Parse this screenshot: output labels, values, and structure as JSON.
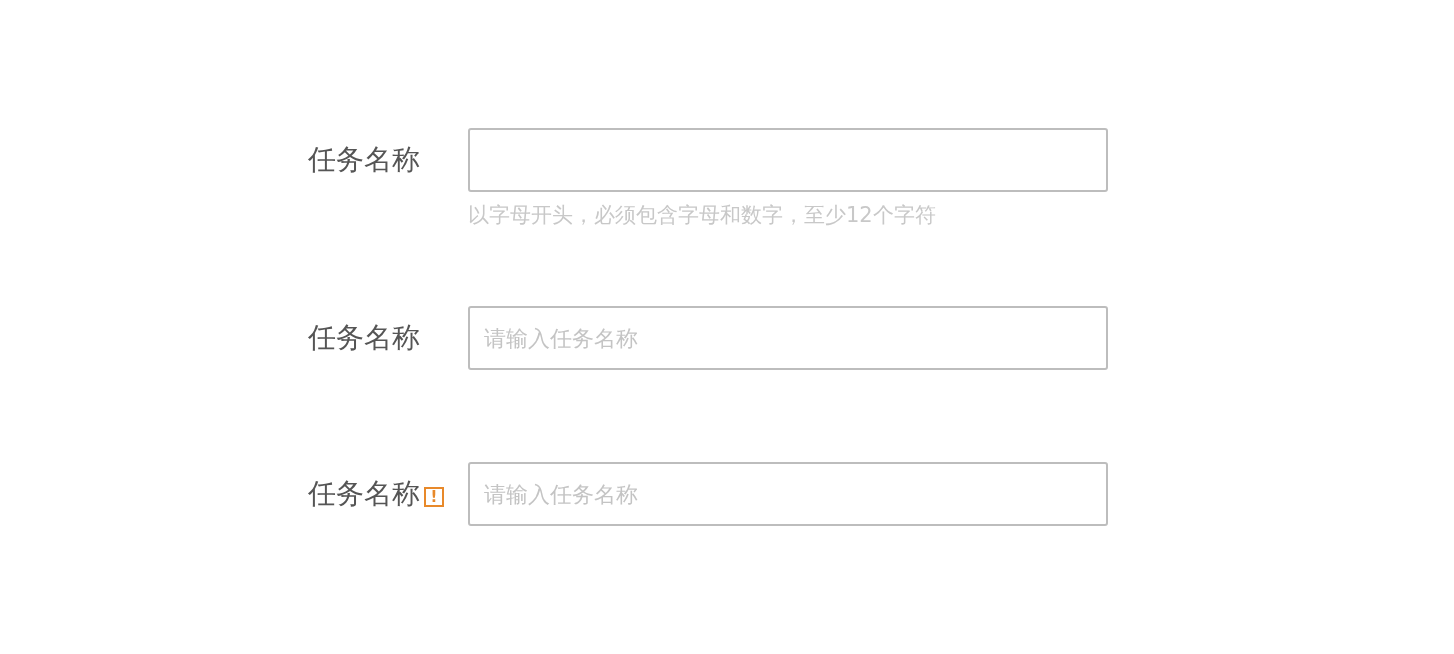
{
  "fields": [
    {
      "label": "任务名称",
      "hint": "以字母开头，必须包含字母和数字，至少12个字符"
    },
    {
      "label": "任务名称",
      "placeholder": "请输入任务名称"
    },
    {
      "label": "任务名称",
      "warning": "!",
      "placeholder": "请输入任务名称"
    }
  ]
}
